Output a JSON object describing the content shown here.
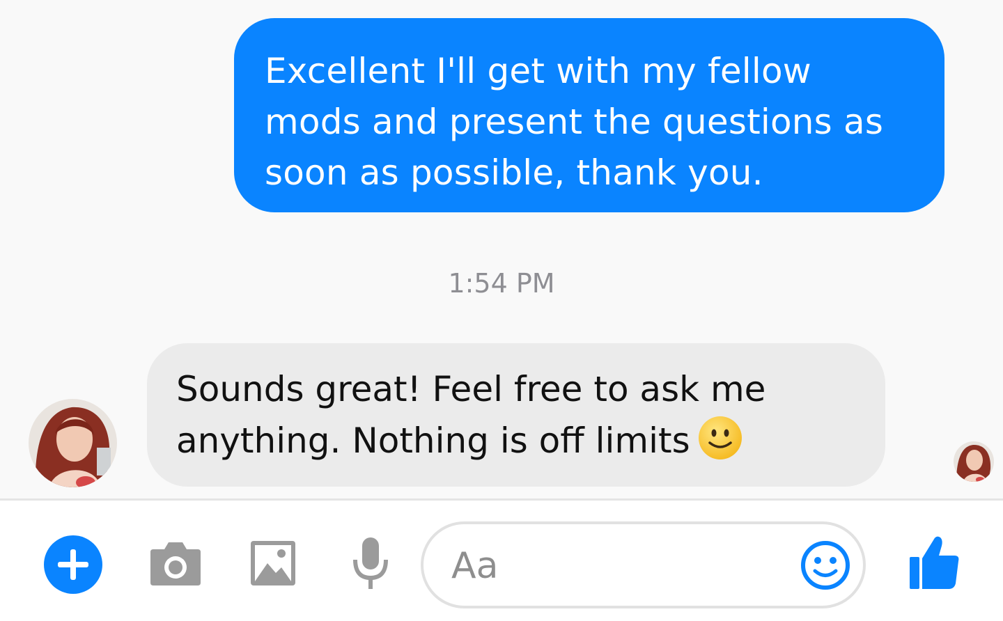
{
  "conversation": {
    "outgoing_message": "Excellent I'll get with my fellow mods and present the questions as soon as possible, thank you.",
    "timestamp": "1:54 PM",
    "incoming_message": "Sounds great! Feel free to ask me anything. Nothing is off limits",
    "incoming_emoji": "slightly-smiling-face"
  },
  "composer": {
    "placeholder": "Aa",
    "buttons": [
      "plus-icon",
      "camera-icon",
      "image-icon",
      "microphone-icon",
      "emoji-icon",
      "thumbs-up-icon"
    ]
  },
  "colors": {
    "accent": "#0a84ff",
    "outgoing_bubble": "#0a84ff",
    "incoming_bubble": "#ebebeb",
    "gray_icon": "#9b9b9b",
    "background": "#f9f9f9"
  }
}
